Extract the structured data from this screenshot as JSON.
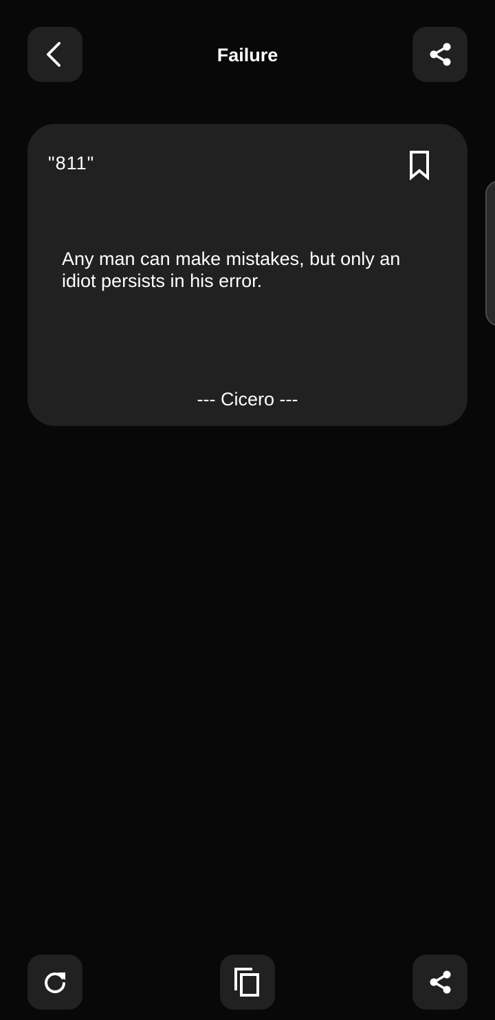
{
  "header": {
    "title": "Failure",
    "back_icon": "chevron-left-icon",
    "share_icon": "share-icon"
  },
  "quote_card": {
    "number": "\"811\"",
    "text": "Any man can make mistakes, but only an idiot persists in his error.",
    "author": "--- Cicero ---",
    "bookmark_icon": "bookmark-outline-icon"
  },
  "bottom_bar": {
    "refresh_icon": "refresh-icon",
    "copy_icon": "copy-icon",
    "share_icon": "share-icon"
  },
  "colors": {
    "background": "#080808",
    "surface": "#212121",
    "text": "#ffffff"
  }
}
